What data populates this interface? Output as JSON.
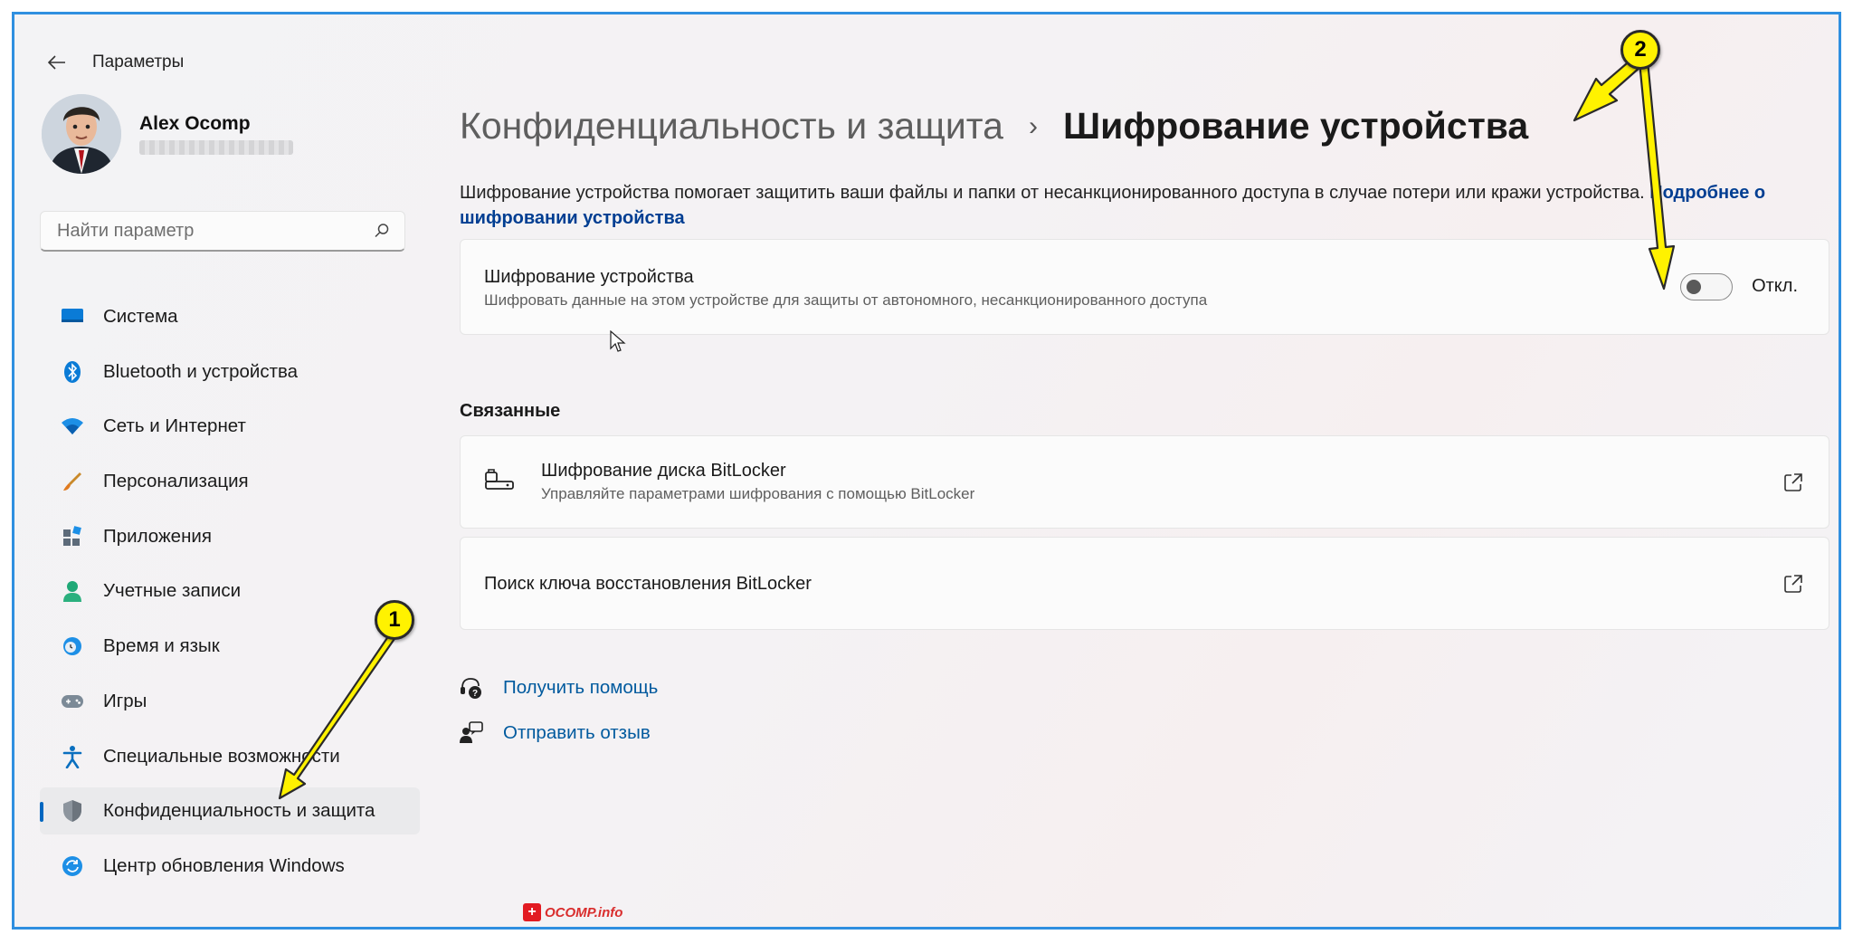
{
  "window": {
    "title": "Параметры"
  },
  "profile": {
    "name": "Alex Ocomp"
  },
  "search": {
    "placeholder": "Найти параметр"
  },
  "sidebar": {
    "items": [
      {
        "label": "Система",
        "icon": "display-icon"
      },
      {
        "label": "Bluetooth и устройства",
        "icon": "bluetooth-icon"
      },
      {
        "label": "Сеть и Интернет",
        "icon": "wifi-icon"
      },
      {
        "label": "Персонализация",
        "icon": "brush-icon"
      },
      {
        "label": "Приложения",
        "icon": "apps-icon"
      },
      {
        "label": "Учетные записи",
        "icon": "person-icon"
      },
      {
        "label": "Время и язык",
        "icon": "clock-globe-icon"
      },
      {
        "label": "Игры",
        "icon": "gamepad-icon"
      },
      {
        "label": "Специальные возможности",
        "icon": "accessibility-icon"
      },
      {
        "label": "Конфиденциальность и защита",
        "icon": "shield-icon",
        "active": true
      },
      {
        "label": "Центр обновления Windows",
        "icon": "sync-icon"
      }
    ]
  },
  "header": {
    "parent": "Конфиденциальность и защита",
    "separator": "›",
    "current": "Шифрование устройства"
  },
  "description": {
    "text": "Шифрование устройства помогает защитить ваши файлы и папки от несанкционированного доступа в случае потери или кражи устройства. ",
    "link": "Подробнее о шифровании устройства"
  },
  "encryption_card": {
    "title": "Шифрование устройства",
    "subtitle": "Шифровать данные на этом устройстве для защиты от автономного, несанкционированного доступа",
    "toggle_state": "Откл.",
    "toggle_on": false
  },
  "related": {
    "title": "Связанные",
    "items": [
      {
        "title": "Шифрование диска BitLocker",
        "subtitle": "Управляйте параметрами шифрования с помощью BitLocker"
      },
      {
        "title": "Поиск ключа восстановления BitLocker"
      }
    ]
  },
  "help": {
    "get_help": "Получить помощь",
    "feedback": "Отправить отзыв"
  },
  "annotations": {
    "badge1": "1",
    "badge2": "2",
    "color": "#fff200"
  },
  "watermark": {
    "text": "OCOMP.info"
  }
}
